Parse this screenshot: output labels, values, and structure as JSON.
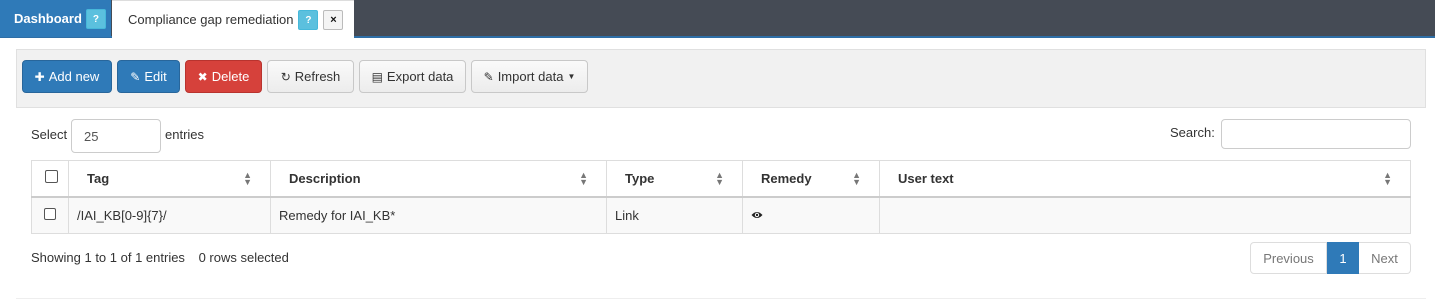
{
  "tabs": [
    {
      "label": "Dashboard",
      "help": "?"
    },
    {
      "label": "Compliance gap remediation",
      "help": "?",
      "close": "×"
    }
  ],
  "toolbar": {
    "add_label": "Add new",
    "edit_label": "Edit",
    "delete_label": "Delete",
    "refresh_label": "Refresh",
    "export_label": "Export data",
    "import_label": "Import data"
  },
  "length": {
    "prefix": "Select",
    "value": "25",
    "suffix": "entries"
  },
  "search": {
    "label": "Search:",
    "value": ""
  },
  "table": {
    "columns": [
      "Tag",
      "Description",
      "Type",
      "Remedy",
      "User text"
    ],
    "rows": [
      {
        "tag": "/IAI_KB[0-9]{7}/",
        "description": "Remedy for IAI_KB*",
        "type": "Link",
        "remedy_icon": "eye-icon",
        "user_text": ""
      }
    ]
  },
  "footer": {
    "info": "Showing 1 to 1 of 1 entries",
    "selected": "0 rows selected",
    "previous": "Previous",
    "page": "1",
    "next": "Next"
  },
  "colors": {
    "primary": "#2f7ab8",
    "danger": "#d6413b",
    "tabbar": "#454b55",
    "info": "#5bc0de"
  }
}
